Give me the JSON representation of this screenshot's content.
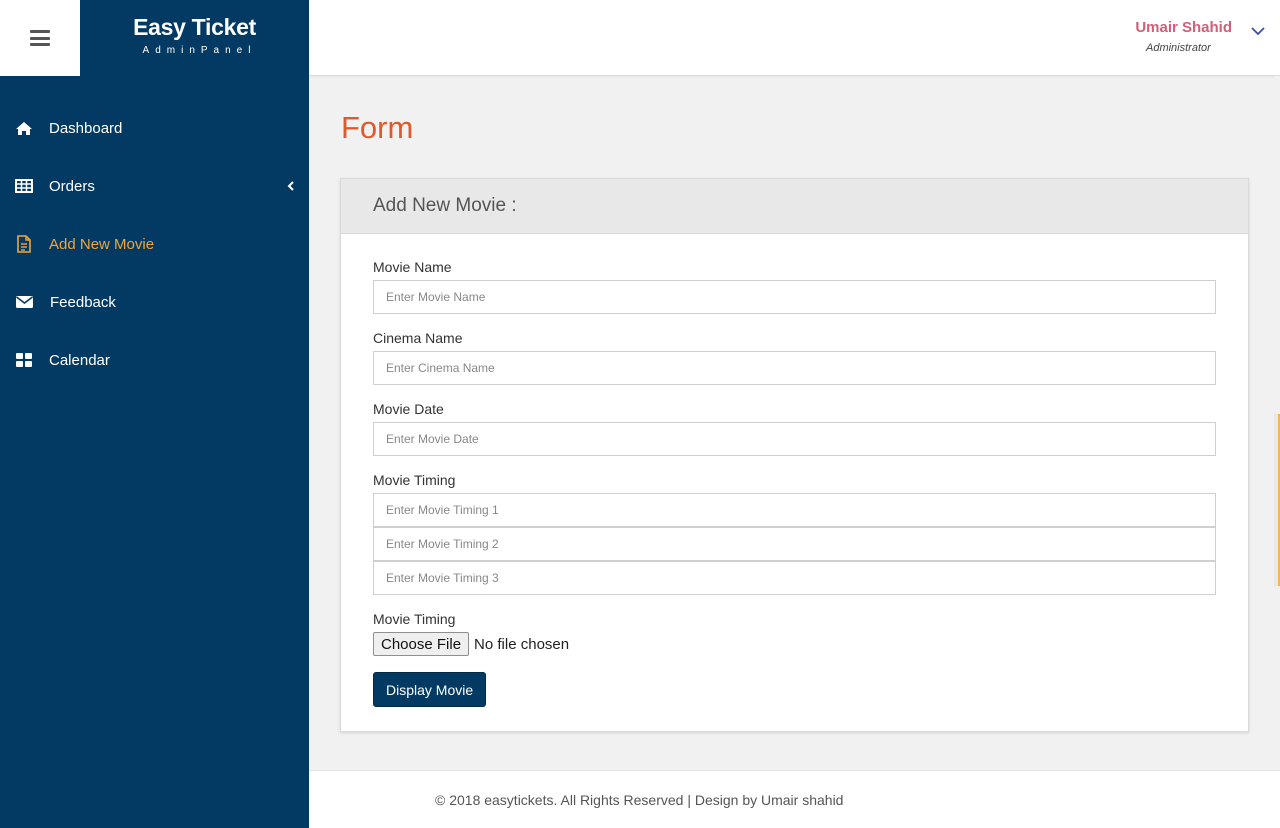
{
  "brand": {
    "title": "Easy Ticket",
    "subtitle": "AdminPanel"
  },
  "sidebar": {
    "items": [
      {
        "label": "Dashboard",
        "icon": "home-icon",
        "active": false
      },
      {
        "label": "Orders",
        "icon": "table-icon",
        "active": false,
        "has_submenu": true
      },
      {
        "label": "Add New Movie",
        "icon": "document-icon",
        "active": true
      },
      {
        "label": "Feedback",
        "icon": "envelope-icon",
        "active": false
      },
      {
        "label": "Calendar",
        "icon": "grid-icon",
        "active": false
      }
    ]
  },
  "user": {
    "name": "Umair Shahid",
    "role": "Administrator"
  },
  "page": {
    "title": "Form"
  },
  "form": {
    "heading": "Add New Movie :",
    "movie_name": {
      "label": "Movie Name",
      "placeholder": "Enter Movie Name",
      "value": ""
    },
    "cinema_name": {
      "label": "Cinema Name",
      "placeholder": "Enter Cinema Name",
      "value": ""
    },
    "movie_date": {
      "label": "Movie Date",
      "placeholder": "Enter Movie Date",
      "value": ""
    },
    "movie_timing": {
      "label": "Movie Timing",
      "placeholders": [
        "Enter Movie Timing 1",
        "Enter Movie Timing 2",
        "Enter Movie Timing 3"
      ]
    },
    "file": {
      "label": "Movie Timing",
      "button": "Choose File",
      "status": "No file chosen"
    },
    "submit": "Display Movie"
  },
  "footer": {
    "text": "© 2018 easytickets. All Rights Reserved | Design by Umair shahid"
  },
  "colors": {
    "sidebar_bg": "#033a63",
    "active_nav": "#f0a53a",
    "page_title": "#e0592a",
    "user_name": "#d15f79"
  }
}
